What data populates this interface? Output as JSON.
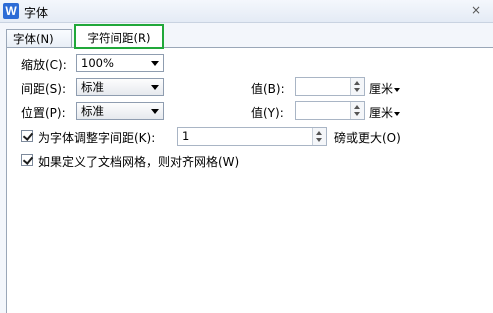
{
  "window": {
    "title": "字体",
    "app_icon_letter": "W",
    "close_glyph": "×"
  },
  "tabs": [
    {
      "label": "字体(N)",
      "active": false
    },
    {
      "label": "字符间距(R)",
      "active": true
    }
  ],
  "fields": {
    "scale": {
      "label": "缩放(C):",
      "value": "100%"
    },
    "spacing": {
      "label": "间距(S):",
      "value": "标准",
      "value_label": "值(B):",
      "amount": "",
      "unit": "厘米"
    },
    "position": {
      "label": "位置(P):",
      "value": "标准",
      "value_label": "值(Y):",
      "amount": "",
      "unit": "厘米"
    },
    "kerning": {
      "label": "为字体调整字间距(K):",
      "checked": true,
      "value": "1",
      "suffix": "磅或更大(O)"
    },
    "grid": {
      "label": "如果定义了文档网格，则对齐网格(W)",
      "checked": true
    }
  },
  "colors": {
    "active_tab_border": "#21a83a",
    "app_icon": "#2d6cd6"
  }
}
